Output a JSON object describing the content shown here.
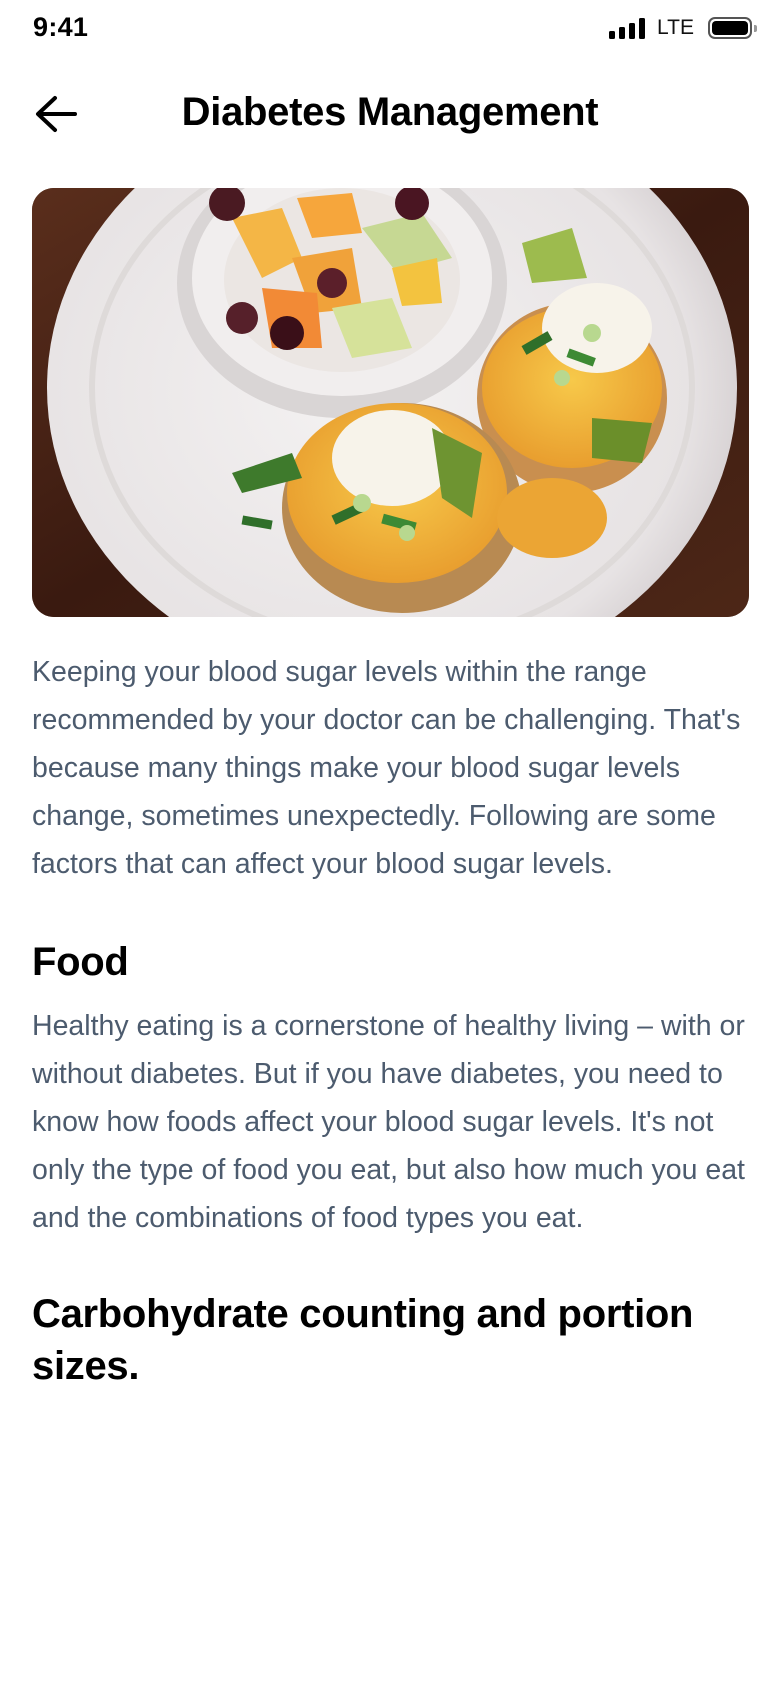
{
  "status_bar": {
    "time": "9:41",
    "network": "LTE",
    "icons": [
      "signal-bars-icon",
      "battery-icon"
    ]
  },
  "header": {
    "title": "Diabetes Management",
    "back_icon": "arrow-left-icon"
  },
  "hero_image": {
    "subject": "eggs benedict with avocado and a bowl of fruit on a white plate"
  },
  "article": {
    "intro": "Keeping your blood sugar levels within the range recommended by your doctor can be challenging. That's because many things make your blood sugar levels change, sometimes unexpectedly. Following are some factors that can affect your blood sugar levels.",
    "sections": [
      {
        "heading": "Food",
        "body": "Healthy eating is a cornerstone of healthy living – with or without diabetes. But if you have diabetes, you need to know how foods affect your blood sugar levels. It's not only the type of food you eat, but also how much you eat and the combinations of food types you eat."
      },
      {
        "heading": "Carbohydrate counting and portion sizes."
      }
    ]
  },
  "colors": {
    "background": "#ffffff",
    "title": "#000000",
    "body_text": "#4c5b6e"
  }
}
